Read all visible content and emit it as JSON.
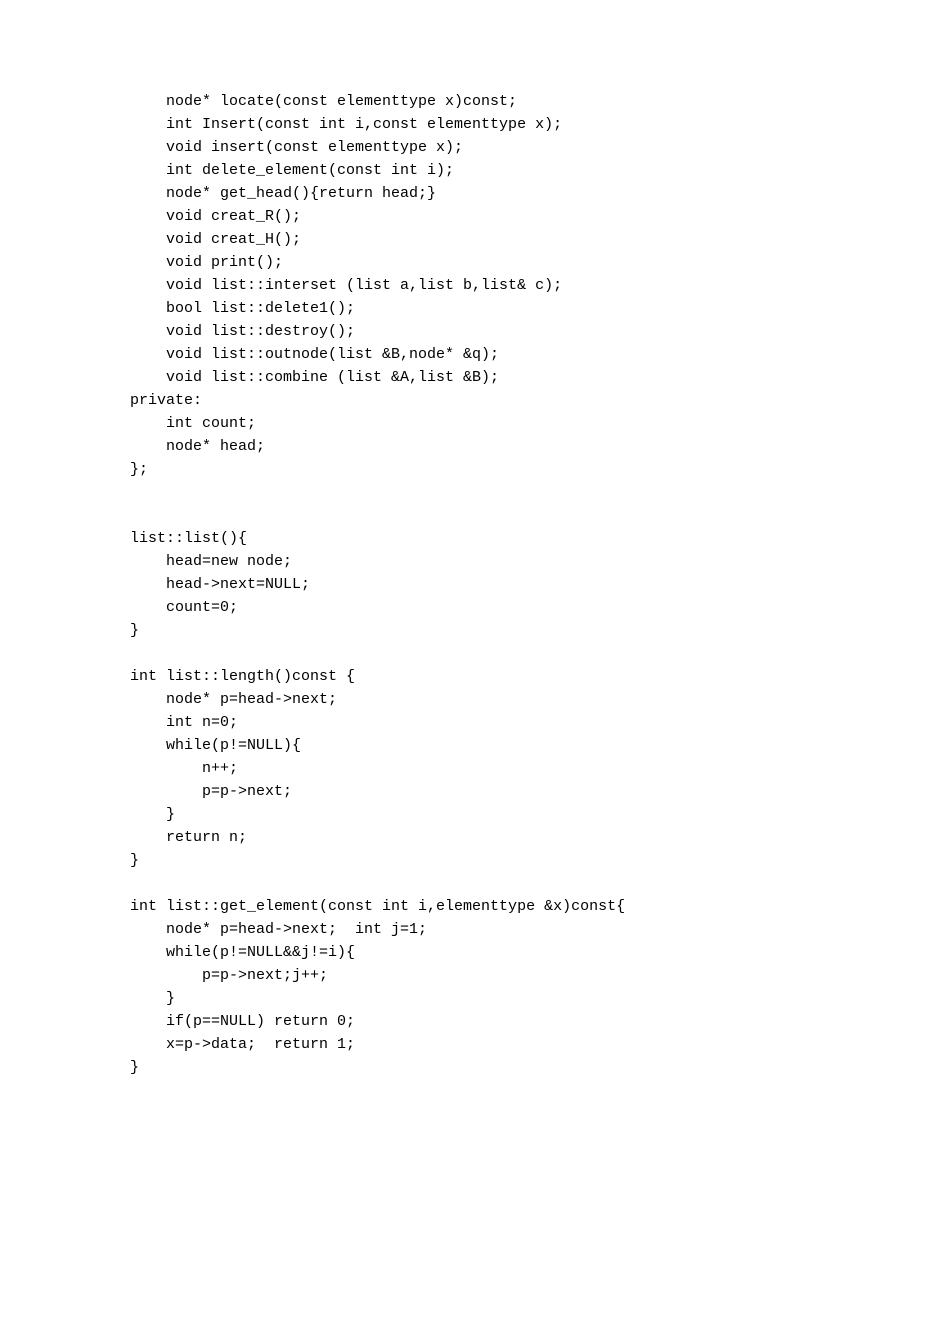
{
  "code_lines": [
    "    node* locate(const elementtype x)const;",
    "    int Insert(const int i,const elementtype x);",
    "    void insert(const elementtype x);",
    "    int delete_element(const int i);",
    "    node* get_head(){return head;}",
    "    void creat_R();",
    "    void creat_H();",
    "    void print();",
    "    void list::interset (list a,list b,list& c);",
    "    bool list::delete1();",
    "    void list::destroy();",
    "    void list::outnode(list &B,node* &q);",
    "    void list::combine (list &A,list &B);",
    "private:",
    "    int count;",
    "    node* head;",
    "};",
    "",
    "",
    "list::list(){",
    "    head=new node;",
    "    head->next=NULL;",
    "    count=0;",
    "}",
    "",
    "int list::length()const {",
    "    node* p=head->next;",
    "    int n=0;",
    "    while(p!=NULL){",
    "        n++;",
    "        p=p->next;",
    "    }",
    "    return n;",
    "}",
    "",
    "int list::get_element(const int i,elementtype &x)const{",
    "    node* p=head->next;  int j=1;",
    "    while(p!=NULL&&j!=i){",
    "        p=p->next;j++;",
    "    }",
    "    if(p==NULL) return 0;",
    "    x=p->data;  return 1;",
    "}"
  ]
}
